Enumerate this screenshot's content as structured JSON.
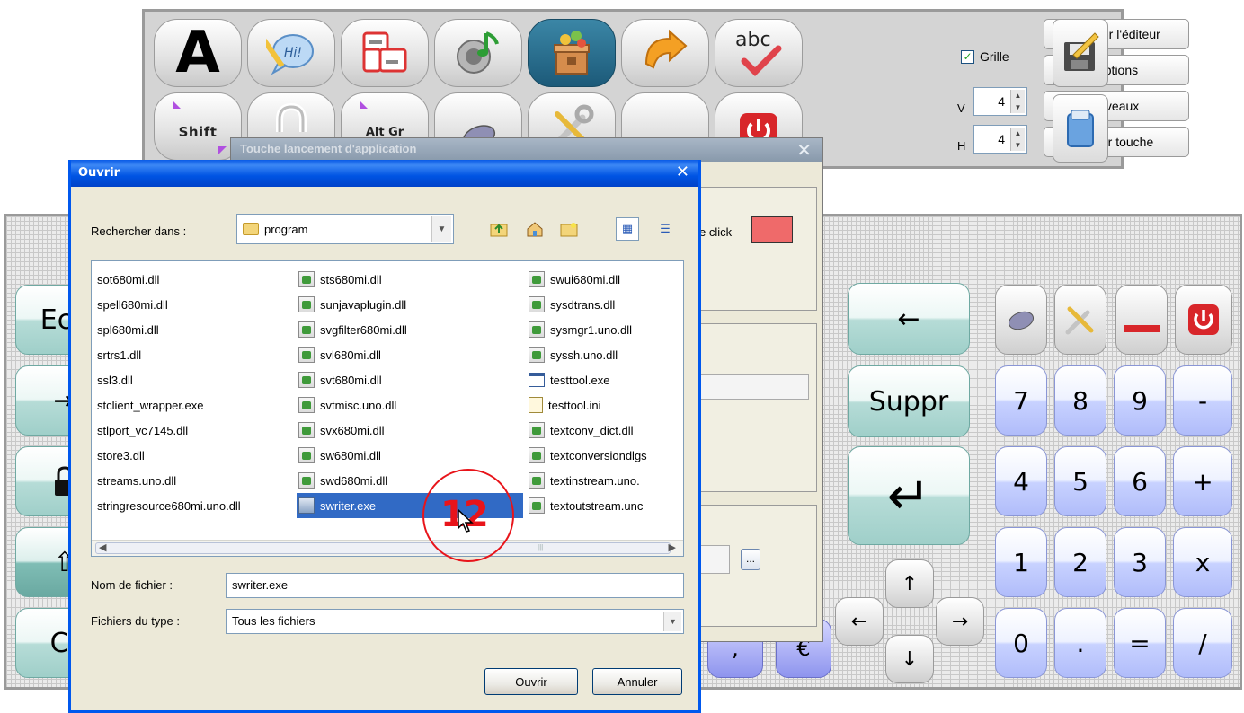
{
  "toolbar": {
    "grid_label": "Grille",
    "grid_checked": true,
    "v_label": "V",
    "h_label": "H",
    "v_value": "4",
    "h_value": "4",
    "close_editor": "Fermer l'éditeur",
    "options": "Options",
    "levels": "Niveaux",
    "edit_key": "Editer touche",
    "letter_a": "A",
    "shift_label": "Shift",
    "altgr_label": "Alt Gr",
    "abc_label": "abc",
    "speech_label": "Hi!"
  },
  "keyboard": {
    "left_keys": [
      "Ech",
      "⇥",
      "🔒",
      "⇧",
      "Ct"
    ],
    "backspace": "←",
    "delete": "Suppr",
    "enter": "↵",
    "arrows": [
      "↑",
      "←",
      "→",
      "↓"
    ],
    "numpad": [
      "7",
      "8",
      "9",
      "-",
      "4",
      "5",
      "6",
      "+",
      "1",
      "2",
      "3",
      "x",
      "0",
      ".",
      "=",
      "/"
    ],
    "purple_keys": [
      ",",
      "€"
    ]
  },
  "launcher": {
    "title": "Touche lancement d'application",
    "click_label": "e click",
    "click_color": "#ef6a6a",
    "browse_label": "..."
  },
  "open_dialog": {
    "title": "Ouvrir",
    "look_in_label": "Rechercher dans :",
    "look_in_value": "program",
    "files_col1": [
      "sot680mi.dll",
      "spell680mi.dll",
      "spl680mi.dll",
      "srtrs1.dll",
      "ssl3.dll",
      "stclient_wrapper.exe",
      "stlport_vc7145.dll",
      "store3.dll",
      "streams.uno.dll",
      "stringresource680mi.uno.dll"
    ],
    "files_col2": [
      "sts680mi.dll",
      "sunjavaplugin.dll",
      "svgfilter680mi.dll",
      "svl680mi.dll",
      "svt680mi.dll",
      "svtmisc.uno.dll",
      "svx680mi.dll",
      "sw680mi.dll",
      "swd680mi.dll",
      "swriter.exe"
    ],
    "files_col3": [
      "swui680mi.dll",
      "sysdtrans.dll",
      "sysmgr1.uno.dll",
      "syssh.uno.dll",
      "testtool.exe",
      "testtool.ini",
      "textconv_dict.dll",
      "textconversiondlgs",
      "textinstream.uno.",
      "textoutstream.unc"
    ],
    "selected_file": "swriter.exe",
    "file_name_label": "Nom de fichier :",
    "file_name_value": "swriter.exe",
    "file_type_label": "Fichiers du type :",
    "file_type_value": "Tous les fichiers",
    "open_button": "Ouvrir",
    "cancel_button": "Annuler"
  },
  "annotation": {
    "step_number": "12",
    "color": "#e8141a"
  }
}
